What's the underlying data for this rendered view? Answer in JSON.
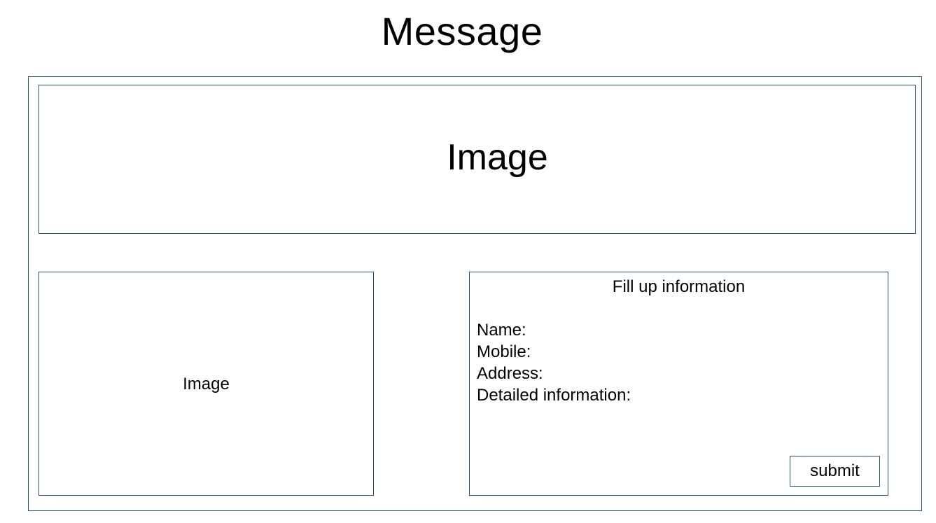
{
  "page": {
    "title": "Message"
  },
  "banner": {
    "label": "Image"
  },
  "side_image": {
    "label": "Image"
  },
  "form": {
    "title": "Fill up information",
    "fields": [
      {
        "label": "Name:"
      },
      {
        "label": "Mobile:"
      },
      {
        "label": "Address:"
      },
      {
        "label": "Detailed information:"
      }
    ],
    "submit_label": "submit"
  },
  "colors": {
    "border": "#2f4f6f",
    "background": "#ffffff",
    "text": "#000000"
  }
}
